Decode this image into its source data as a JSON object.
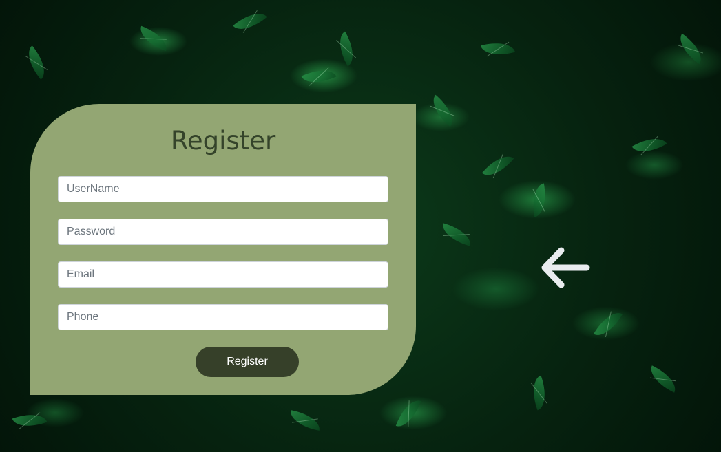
{
  "page": {
    "background": "dark green leaves",
    "card_color": "#93a673",
    "accent": "#364029"
  },
  "form": {
    "title": "Register",
    "fields": [
      {
        "placeholder": "UserName",
        "value": ""
      },
      {
        "placeholder": "Password",
        "value": ""
      },
      {
        "placeholder": "Email",
        "value": ""
      },
      {
        "placeholder": "Phone",
        "value": ""
      }
    ],
    "submit_label": "Register"
  },
  "nav": {
    "back_icon": "arrow-left-icon"
  }
}
